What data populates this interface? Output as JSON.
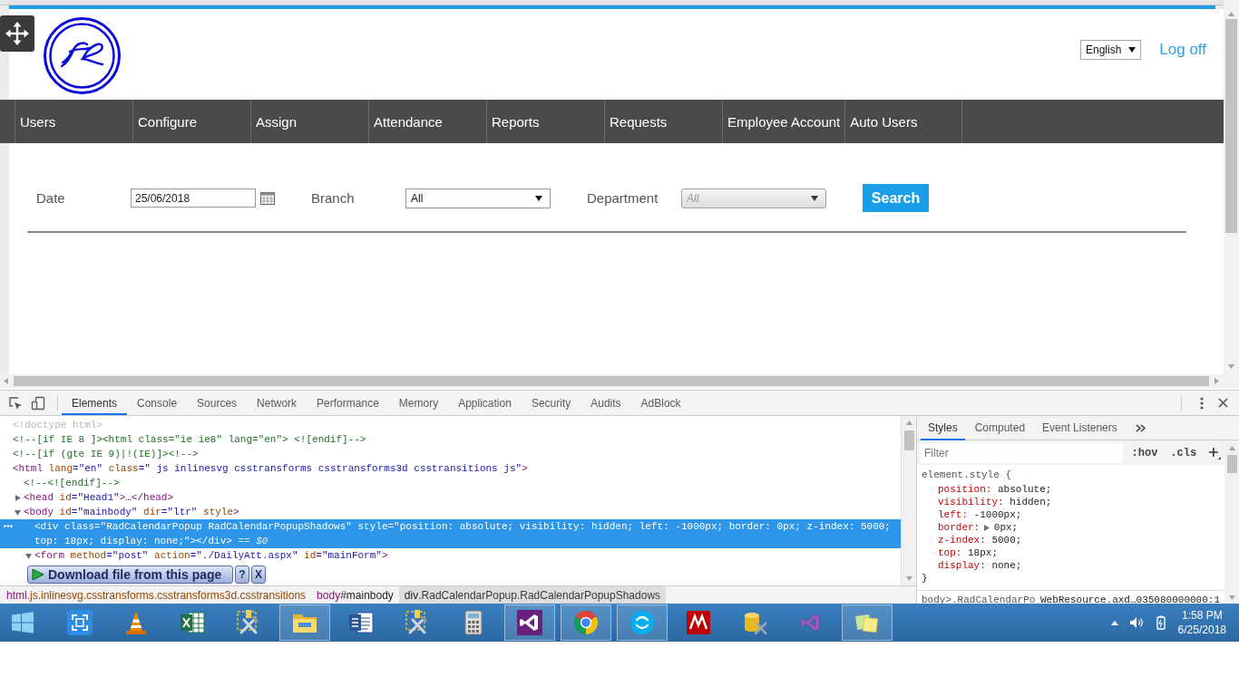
{
  "page": {
    "language_select": {
      "value": "English"
    },
    "logoff": "Log off",
    "nav": [
      "Users",
      "Configure",
      "Assign",
      "Attendance",
      "Reports",
      "Requests",
      "Employee Account",
      "Auto Users"
    ],
    "filters": {
      "date": {
        "label": "Date",
        "value": "25/06/2018"
      },
      "branch": {
        "label": "Branch",
        "value": "All",
        "disabled": false
      },
      "department": {
        "label": "Department",
        "value": "All",
        "disabled": true
      },
      "search_button": "Search"
    }
  },
  "devtools": {
    "tabs": [
      {
        "label": "Elements",
        "selected": true
      },
      {
        "label": "Console",
        "selected": false
      },
      {
        "label": "Sources",
        "selected": false
      },
      {
        "label": "Network",
        "selected": false
      },
      {
        "label": "Performance",
        "selected": false
      },
      {
        "label": "Memory",
        "selected": false
      },
      {
        "label": "Application",
        "selected": false
      },
      {
        "label": "Security",
        "selected": false
      },
      {
        "label": "Audits",
        "selected": false
      },
      {
        "label": "AdBlock",
        "selected": false
      }
    ],
    "dom_tree": [
      {
        "selected": false,
        "tokens": [
          {
            "kind": "doctype",
            "text": "<!doctype html>"
          }
        ]
      },
      {
        "selected": false,
        "tokens": [
          {
            "kind": "comment",
            "text": "<!--[if IE 8 ]><html class=\"ie ie8\" lang=\"en\"> <![endif]-->"
          }
        ]
      },
      {
        "selected": false,
        "tokens": [
          {
            "kind": "comment",
            "text": "<!--[if (gte IE 9)|!(IE)]><!-->"
          }
        ]
      },
      {
        "selected": false,
        "tokens": [
          {
            "kind": "tag",
            "text": "<html"
          },
          {
            "kind": "attr",
            "text": " lang"
          },
          {
            "kind": "value",
            "text": "=\"en\""
          },
          {
            "kind": "attr",
            "text": " class"
          },
          {
            "kind": "value",
            "text": "=\" js inlinesvg csstransforms csstransforms3d csstransitions js\""
          },
          {
            "kind": "tag",
            "text": ">"
          }
        ],
        "children": [
          {
            "selected": false,
            "tokens": [
              {
                "kind": "comment",
                "text": "<!--<![endif]-->"
              }
            ]
          },
          {
            "selected": false,
            "expanded": false,
            "tokens": [
              {
                "kind": "tag",
                "text": "<head"
              },
              {
                "kind": "attr",
                "text": " id"
              },
              {
                "kind": "value",
                "text": "=\"Head1\""
              },
              {
                "kind": "tag",
                "text": ">"
              },
              {
                "kind": "text",
                "text": "…"
              },
              {
                "kind": "tag",
                "text": "</head>"
              }
            ]
          },
          {
            "selected": false,
            "expanded": true,
            "tokens": [
              {
                "kind": "tag",
                "text": "<body"
              },
              {
                "kind": "attr",
                "text": " id"
              },
              {
                "kind": "value",
                "text": "=\"mainbody\""
              },
              {
                "kind": "attr",
                "text": " dir"
              },
              {
                "kind": "value",
                "text": "=\"ltr\""
              },
              {
                "kind": "attr",
                "text": " style"
              },
              {
                "kind": "tag",
                "text": ">"
              }
            ],
            "children": [
              {
                "selected": true,
                "tokens": [
                  {
                    "kind": "tag",
                    "text": "<div"
                  },
                  {
                    "kind": "attr",
                    "text": " class"
                  },
                  {
                    "kind": "value",
                    "text": "=\"RadCalendarPopup RadCalendarPopupShadows\""
                  },
                  {
                    "kind": "attr",
                    "text": " style"
                  },
                  {
                    "kind": "value",
                    "text": "=\"position: absolute; visibility: hidden; left: -1000px; border: 0px; z-index: 5000; top: 18px; display: none;\""
                  },
                  {
                    "kind": "tag",
                    "text": "></div>"
                  }
                ],
                "suffix": "== $0"
              },
              {
                "selected": false,
                "expanded": true,
                "tokens": [
                  {
                    "kind": "tag",
                    "text": "<form"
                  },
                  {
                    "kind": "attr",
                    "text": " method"
                  },
                  {
                    "kind": "value",
                    "text": "=\"post\""
                  },
                  {
                    "kind": "attr",
                    "text": " action"
                  },
                  {
                    "kind": "value",
                    "text": "=\"./DailyAtt.aspx\""
                  },
                  {
                    "kind": "attr",
                    "text": " id"
                  },
                  {
                    "kind": "value",
                    "text": "=\"mainForm\""
                  },
                  {
                    "kind": "tag",
                    "text": ">"
                  }
                ]
              }
            ]
          }
        ]
      }
    ],
    "breadcrumbs": [
      {
        "selected": false,
        "tokens": [
          {
            "kind": "tag",
            "text": "html"
          },
          {
            "kind": "attr",
            "text": ".js.inlinesvg.csstransforms.csstransforms3d.csstransitions"
          }
        ]
      },
      {
        "selected": false,
        "tokens": [
          {
            "kind": "tag",
            "text": "body"
          },
          {
            "kind": "text",
            "text": "#mainbody"
          }
        ]
      },
      {
        "selected": true,
        "tokens": [
          {
            "kind": "tag",
            "text": "div"
          },
          {
            "kind": "attr",
            "text": ".RadCalendarPopup.RadCalendarPopupShadows"
          }
        ]
      }
    ],
    "styles_tabs": [
      {
        "label": "Styles",
        "selected": true
      },
      {
        "label": "Computed",
        "selected": false
      },
      {
        "label": "Event Listeners",
        "selected": false
      }
    ],
    "filter": {
      "placeholder": "Filter"
    },
    "filter_buttons": [
      ":hov",
      ".cls"
    ],
    "rule": {
      "selector": "element.style {",
      "declarations": [
        {
          "kind": "plain",
          "property": "position:",
          "value": "absolute;"
        },
        {
          "kind": "plain",
          "property": "visibility:",
          "value": "hidden;"
        },
        {
          "kind": "plain",
          "property": "left:",
          "value": "-1000px;"
        },
        {
          "kind": "shorthand",
          "expanded": false,
          "property": "border:",
          "value": "0px;"
        },
        {
          "kind": "plain",
          "property": "z-index:",
          "value": "5000;"
        },
        {
          "kind": "plain",
          "property": "top:",
          "value": "18px;"
        },
        {
          "kind": "plain",
          "property": "display:",
          "value": "none;"
        }
      ],
      "close": "}"
    },
    "next_rule": {
      "selector": "body>.RadCalendarPo",
      "source": "WebResource.axd…035080000000:1"
    }
  },
  "download_bar": {
    "label": "Download file from this page",
    "help": "?",
    "close": "X"
  },
  "taskbar": {
    "apps": [
      {
        "kind": "capture",
        "running": false
      },
      {
        "kind": "cone",
        "running": false
      },
      {
        "kind": "spreadsheet",
        "running": false
      },
      {
        "kind": "tools",
        "running": false
      },
      {
        "kind": "folder",
        "running": true
      },
      {
        "kind": "document",
        "running": false
      },
      {
        "kind": "tools",
        "running": false
      },
      {
        "kind": "calculator",
        "running": false
      },
      {
        "kind": "ide",
        "running": true
      },
      {
        "kind": "browser",
        "running": true
      },
      {
        "kind": "chat",
        "running": true
      },
      {
        "kind": "ftp",
        "running": false
      },
      {
        "kind": "database",
        "running": false
      },
      {
        "kind": "ide_outline",
        "running": false
      },
      {
        "kind": "notes",
        "running": true
      }
    ],
    "clock": {
      "time": "1:58 PM",
      "date": "6/25/2018"
    }
  }
}
